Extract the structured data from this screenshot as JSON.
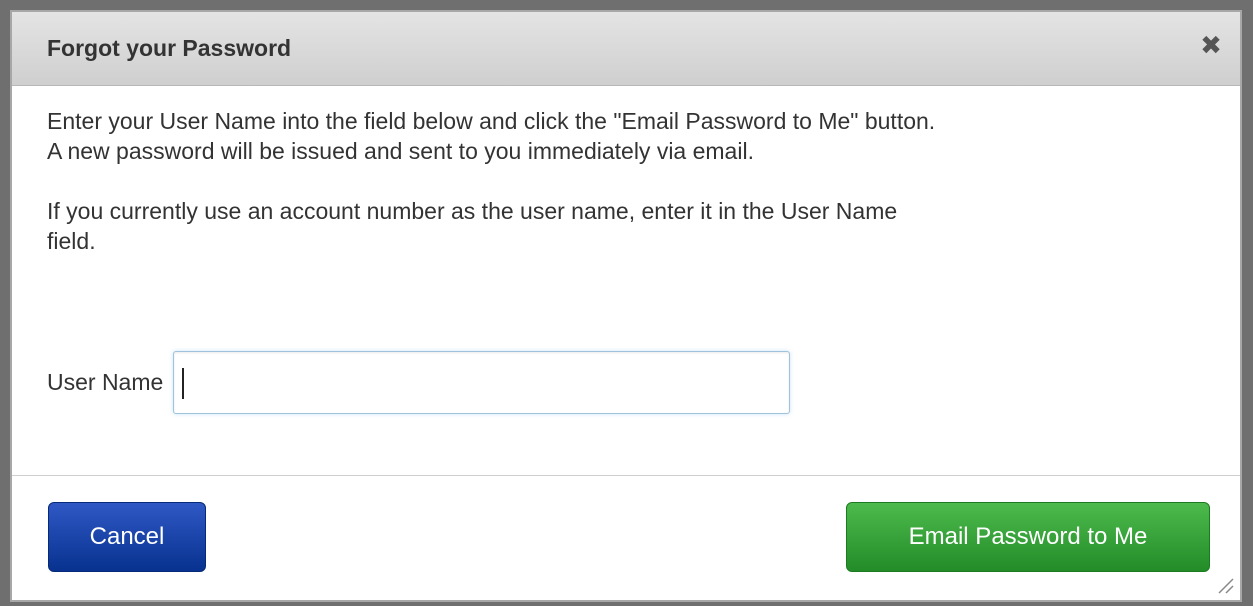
{
  "dialog": {
    "title": "Forgot your Password",
    "close_icon": "close-icon",
    "paragraph_1_line_1": "Enter your User Name into the field below and click the \"Email Password to Me\" button.",
    "paragraph_1_line_2": "A new password will be issued and sent to you immediately via email.",
    "paragraph_2_line_1": "If you currently use an account number as the user name, enter it in the User Name",
    "paragraph_2_line_2": "field.",
    "username_label": "User Name",
    "username_value": "",
    "cancel_label": "Cancel",
    "submit_label": "Email Password to Me"
  },
  "colors": {
    "cancel_button": "#0a3a9e",
    "submit_button": "#2e9e34",
    "titlebar": "#d8d8d8"
  }
}
